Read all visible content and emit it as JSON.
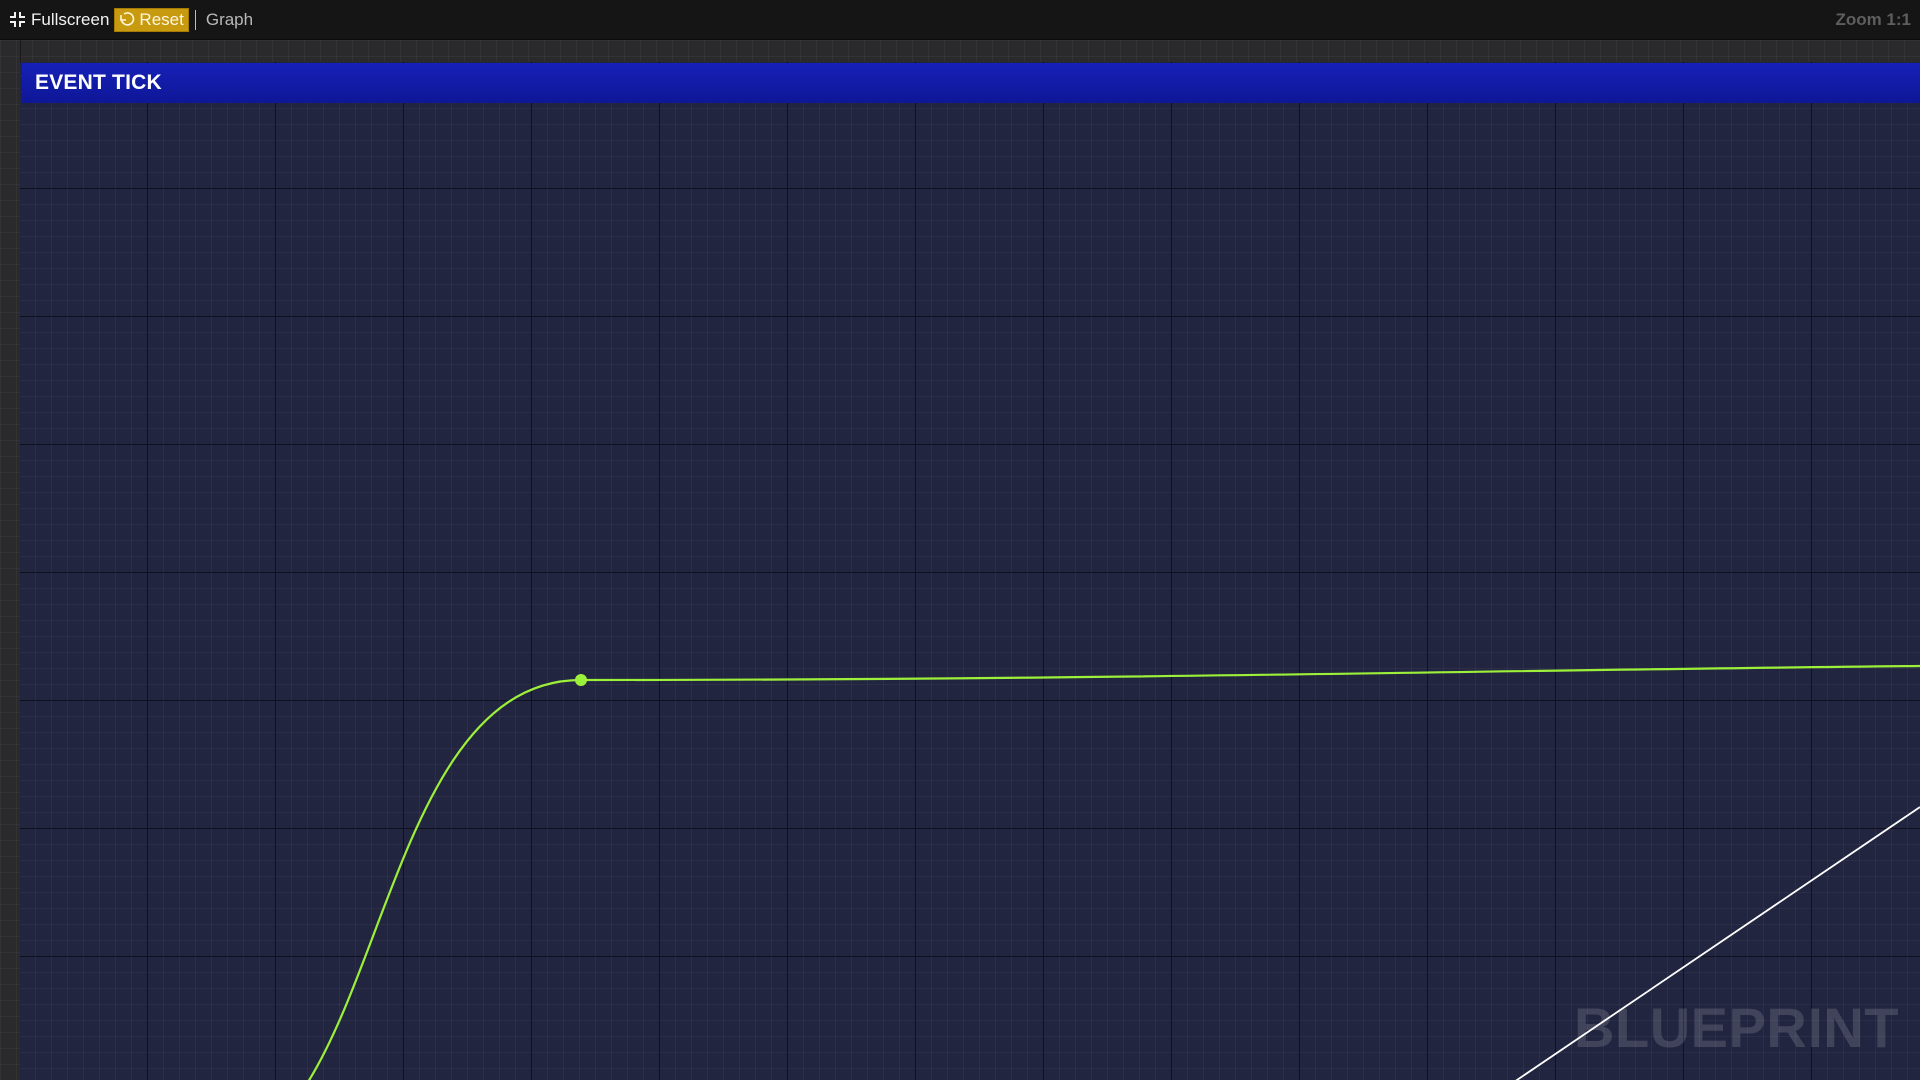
{
  "toolbar": {
    "fullscreen_label": "Fullscreen",
    "reset_label": "Reset",
    "graph_label": "Graph",
    "zoom_label": "Zoom 1:1"
  },
  "node": {
    "title": "EVENT TICK",
    "header_color": "#1620b8"
  },
  "wires": {
    "exec_color": "#9cf03a",
    "data_color": "#ffffff"
  },
  "watermark": "BLUEPRINT",
  "icons": {
    "fullscreen": "fullscreen-icon",
    "reset": "reset-icon"
  }
}
